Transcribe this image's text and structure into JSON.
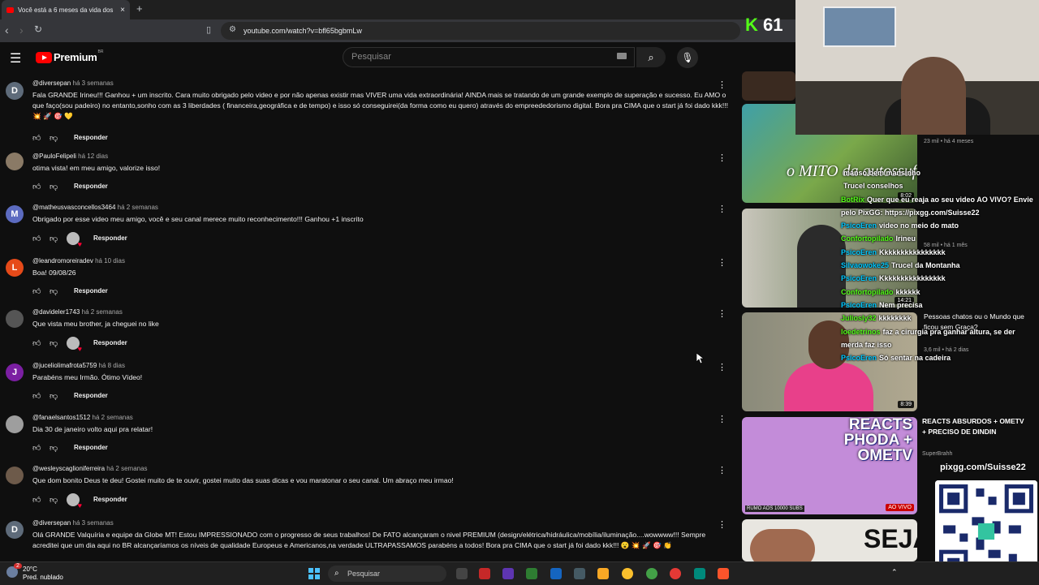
{
  "browser": {
    "tab_title": "Você está a 6 meses da vida dos",
    "close_tab": "×",
    "new_tab": "+",
    "url": "youtube.com/watch?v=bfl65bgbmLw"
  },
  "youtube": {
    "logo_text": "Premium",
    "logo_region": "BR",
    "search_placeholder": "Pesquisar"
  },
  "comments": [
    {
      "author": "@diversepan",
      "time": "há 3 semanas",
      "avatar_letter": "D",
      "avatar_color": "#5e6b7a",
      "text": "Fala GRANDE Irineu!!! Ganhou + um inscrito. Cara muito obrigado pelo video e por não apenas existir mas VIVER uma vida extraordinária! AINDA mais se tratando de um grande exemplo de superação e sucesso. Eu AMO o que faço(sou padeiro) no entanto,sonho com as 3 liberdades ( financeira,geográfica e de tempo) e isso só conseguirei(da forma como eu quero) através do empreededorismo digital. Bora pra CIMA que o start já foi dado kkk!!! 💥 🚀 🎯 💛",
      "reply": "Responder",
      "creator_heart": false
    },
    {
      "author": "@PauloFelipeli",
      "time": "há 12 dias",
      "avatar_letter": "",
      "avatar_color": "#8a7a66",
      "text": "otima vista! em meu amigo, valorize isso!",
      "reply": "Responder",
      "creator_heart": false
    },
    {
      "author": "@matheusvasconcellos3464",
      "time": "há 2 semanas",
      "avatar_letter": "M",
      "avatar_color": "#5c6bc0",
      "text": "Obrigado por esse video meu amigo, você e seu canal merece muito reconhecimento!!! Ganhou +1 inscrito",
      "reply": "Responder",
      "creator_heart": true
    },
    {
      "author": "@leandromoreiradev",
      "time": "há 10 dias",
      "avatar_letter": "L",
      "avatar_color": "#e64a19",
      "text": "Boa! 09/08/26",
      "reply": "Responder",
      "creator_heart": false
    },
    {
      "author": "@davideler1743",
      "time": "há 2 semanas",
      "avatar_letter": "",
      "avatar_color": "#555555",
      "text": "Que vista meu brother, ja cheguei no like",
      "reply": "Responder",
      "creator_heart": true
    },
    {
      "author": "@juceliolimafrota5759",
      "time": "há 8 dias",
      "avatar_letter": "J",
      "avatar_color": "#7b1fa2",
      "text": "Parabéns meu Irmão. Ótimo Vídeo!",
      "reply": "Responder",
      "creator_heart": false
    },
    {
      "author": "@fanaelsantos1512",
      "time": "há 2 semanas",
      "avatar_letter": "",
      "avatar_color": "#9e9e9e",
      "text": "Dia 30 de janeiro volto aqui pra relatar!",
      "reply": "Responder",
      "creator_heart": false
    },
    {
      "author": "@wesleyscaglioniferreira",
      "time": "há 2 semanas",
      "avatar_letter": "",
      "avatar_color": "#6d5a4a",
      "text": "Que dom bonito Deus te deu! Gostei muito de te ouvir, gostei muito das suas dicas e vou maratonar o seu canal. Um abraço meu irmao!",
      "reply": "Responder",
      "creator_heart": true
    },
    {
      "author": "@diversepan",
      "time": "há 3 semanas",
      "avatar_letter": "D",
      "avatar_color": "#5e6b7a",
      "text": "Olá GRANDE Valquíria e equipe da Globe MT! Estou IMPRESSIONADO com o progresso de seus trabalhos! De FATO alcançaram o nivel PREMIUM (design/elétrica/hidráulica/mobília/iluminação....wowwww!!! Sempre acreditei que um dia aqui no BR alcançaríamos os níveis de qualidade Europeus e Americanos,na verdade ULTRAPASSAMOS parabéns a todos! Bora pra CIMA que o start já foi dado kkk!!! 😮 💥 🚀 🎯 👏",
      "reply": "",
      "creator_heart": false
    }
  ],
  "suggested": [
    {
      "title": "o MITO da autossuficiência",
      "duration": "8:02",
      "meta": "23 mil • há 4 meses"
    },
    {
      "title": "",
      "duration": "14:21",
      "meta": "58 mil • há 1 mês"
    },
    {
      "title": "Pessoas chatos ou o Mundo que ficou sem Graça?",
      "duration": "8:39",
      "meta": "3,6 mil • há 2 dias"
    },
    {
      "title": "REACTS ABSURDOS + OMETV + PRECISO DE DINDIN",
      "duration": "AO VIVO",
      "channel": "SuperBrahh",
      "thumb_text": "REACTS PHODA + OMETV",
      "thumb_sub": "RUMO AOS 10000 SUBS"
    },
    {
      "title": "SEJA",
      "duration": "",
      "meta": ""
    }
  ],
  "stream": {
    "kick_count": "61",
    "chat": [
      {
        "user": "",
        "msg": "manso bem mansinho",
        "color": "#53fc18"
      },
      {
        "user": "",
        "msg": "Trucel conselhos",
        "color": "#53fc18"
      },
      {
        "user": "BotRix",
        "msg": "Quer que eu reaja ao seu video AO VIVO? Envie pelo PixGG: https://pixgg.com/Suisse22",
        "color": "#53fc18"
      },
      {
        "user": "PsicoEren",
        "msg": "video no meio do mato",
        "color": "#00c8ff"
      },
      {
        "user": "Confortopilado",
        "msg": "Irineu",
        "color": "#53fc18"
      },
      {
        "user": "PsicoEren",
        "msg": "Kkkkkkkkkkkkkkkk",
        "color": "#00c8ff"
      },
      {
        "user": "Silvaowoke25",
        "msg": "Trucel da Montanha",
        "color": "#00c8ff"
      },
      {
        "user": "PsicoEren",
        "msg": "Kkkkkkkkkkkkkkkk",
        "color": "#00c8ff"
      },
      {
        "user": "Confortopilado",
        "msg": "kkkkkk",
        "color": "#53fc18"
      },
      {
        "user": "PsicoEren",
        "msg": "Nem precisa",
        "color": "#00c8ff"
      },
      {
        "user": "Juliosly32",
        "msg": "kkkkkkkk",
        "color": "#53fc18"
      },
      {
        "user": "loedetrinos",
        "msg": "faz a cirurgia pra ganhar altura, se der merda faz isso",
        "color": "#53fc18"
      },
      {
        "user": "PsicoEren",
        "msg": "Só sentar na cadeira",
        "color": "#00c8ff"
      }
    ],
    "pix_url": "pixgg.com/Suisse22"
  },
  "taskbar": {
    "temperature": "20°C",
    "weather": "Pred. nublado",
    "search": "Pesquisar",
    "notif": "2"
  }
}
